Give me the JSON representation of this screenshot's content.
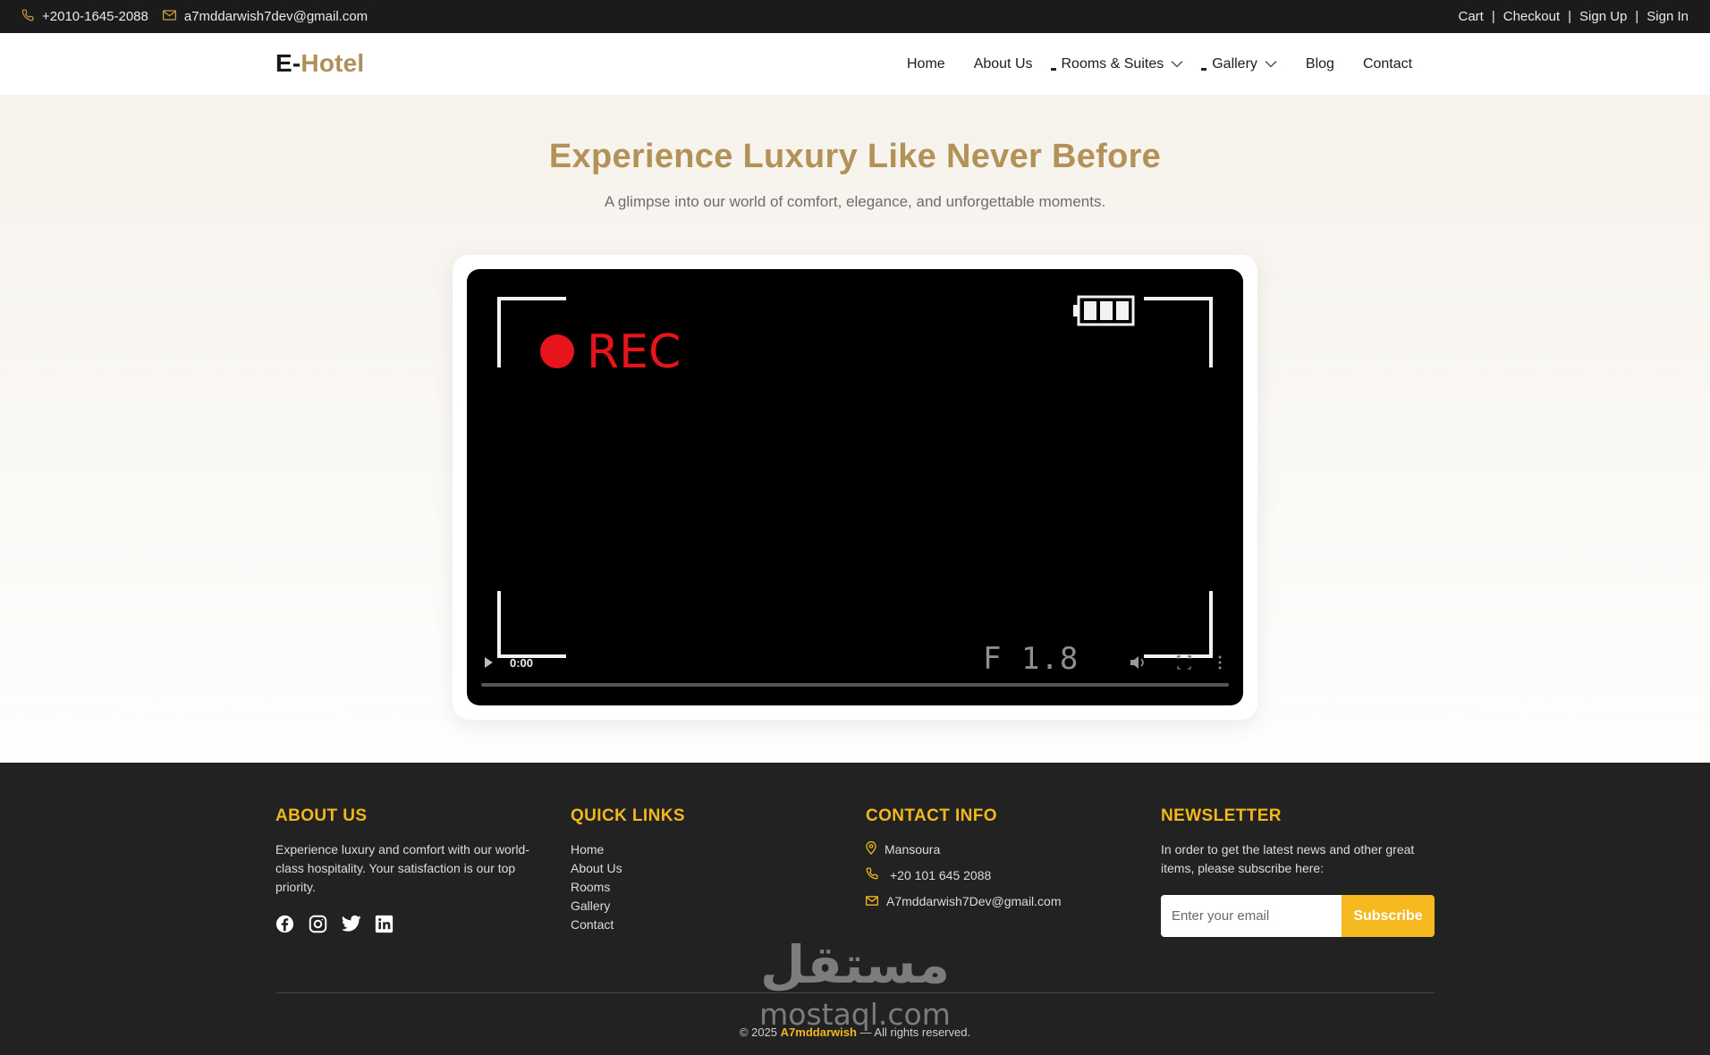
{
  "topbar": {
    "phone": "+2010-1645-2088",
    "email": "a7mddarwish7dev@gmail.com",
    "links": [
      "Cart",
      "Checkout",
      "Sign Up",
      "Sign In"
    ]
  },
  "nav": {
    "logo_part1": "E-",
    "logo_part2": "Hotel",
    "items": [
      "Home",
      "About Us",
      "Rooms & Suites",
      "Gallery",
      "Blog",
      "Contact"
    ]
  },
  "hero": {
    "title": "Experience Luxury Like Never Before",
    "subtitle": "A glimpse into our world of comfort, elegance, and unforgettable moments."
  },
  "video": {
    "rec_label": "REC",
    "aperture": "F 1.8",
    "time": "0:00"
  },
  "footer": {
    "about": {
      "heading": "ABOUT US",
      "text": "Experience luxury and comfort with our world-class hospitality. Your satisfaction is our top priority."
    },
    "quick_links": {
      "heading": "QUICK LINKS",
      "items": [
        "Home",
        "About Us",
        "Rooms",
        "Gallery",
        "Contact"
      ]
    },
    "contact": {
      "heading": "CONTACT INFO",
      "location": "Mansoura",
      "phone": "+20 101 645 2088",
      "email": "A7mddarwish7Dev@gmail.com"
    },
    "newsletter": {
      "heading": "NEWSLETTER",
      "text": "In order to get the latest news and other great items, please subscribe here:",
      "placeholder": "Enter your email",
      "button": "Subscribe"
    },
    "copyright_prefix": "© 2025",
    "copyright_brand": "A7mddarwish",
    "copyright_suffix": "— All rights reserved.",
    "watermark_ar": "مستقل",
    "watermark_en": "mostaql.com"
  },
  "colors": {
    "gold": "#b39257",
    "yellow": "#f3b71b",
    "dark": "#222222",
    "rec_red": "#e8141b"
  }
}
